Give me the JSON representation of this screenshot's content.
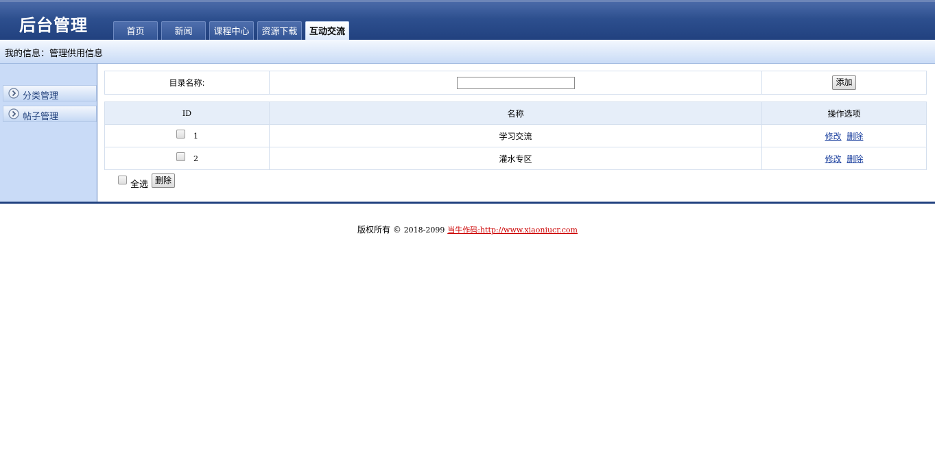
{
  "header": {
    "logo": "后台管理",
    "tabs": [
      {
        "label": "首页"
      },
      {
        "label": "新闻"
      },
      {
        "label": "课程中心"
      },
      {
        "label": "资源下载"
      },
      {
        "label": "互动交流",
        "active": true
      }
    ]
  },
  "infobar": {
    "text": "我的信息：管理供用信息"
  },
  "sidebar": {
    "items": [
      {
        "label": "分类管理",
        "icon": "circle-arrow-right-icon"
      },
      {
        "label": "帖子管理",
        "icon": "circle-arrow-right-icon"
      }
    ]
  },
  "form": {
    "label": "目录名称:",
    "input_value": "",
    "add_button": "添加"
  },
  "table": {
    "headers": [
      "ID",
      "名称",
      "操作选项"
    ],
    "rows": [
      {
        "id": "1",
        "name": "学习交流",
        "edit": "修改",
        "delete": "删除"
      },
      {
        "id": "2",
        "name": "灌水专区",
        "edit": "修改",
        "delete": "删除"
      }
    ]
  },
  "bulk": {
    "select_all": "全选",
    "delete_button": "删除"
  },
  "footer": {
    "copyright": "版权所有",
    "symbol": "©",
    "years": "2018-2099",
    "credit": "当牛作码:http://www.xiaoniucr.com"
  },
  "colors": {
    "header_blue": "#21417f",
    "link_blue": "#1a3f9e",
    "credit_red": "#cc0000"
  }
}
